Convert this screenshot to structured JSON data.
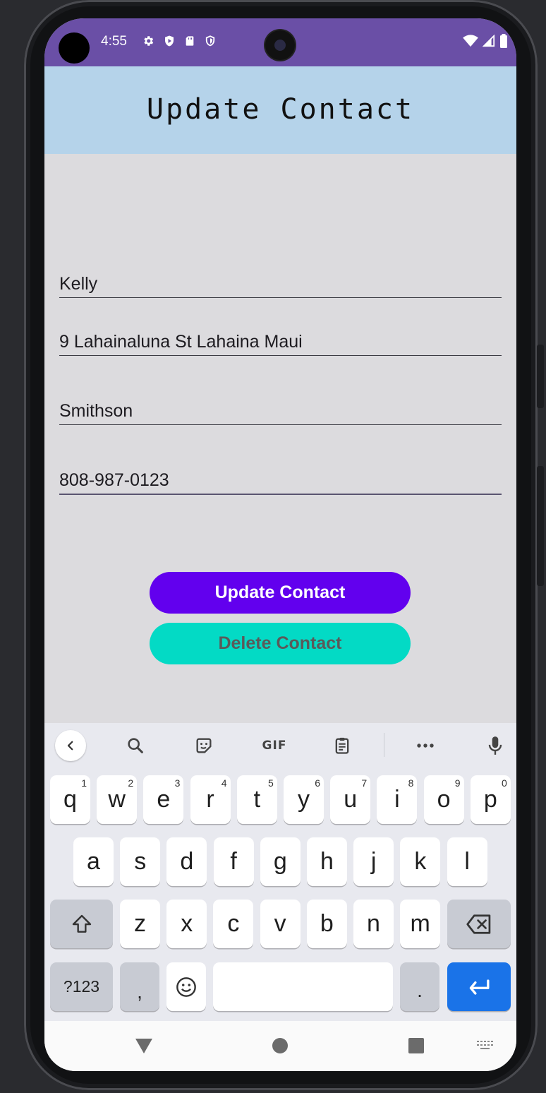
{
  "status_bar": {
    "time": "4:55",
    "left_icons": [
      "gear-icon",
      "play-shield-icon",
      "sd-card-icon",
      "shield-icon"
    ],
    "right_icons": [
      "wifi-icon",
      "signal-icon",
      "battery-icon"
    ]
  },
  "header": {
    "title": "Update Contact"
  },
  "form": {
    "name": "Kelly",
    "address": "9 Lahainaluna St Lahaina Maui",
    "last_name": "Smithson",
    "phone": "808-987-0123"
  },
  "buttons": {
    "update_label": "Update Contact",
    "delete_label": "Delete Contact"
  },
  "colors": {
    "status_bar": "#6a4fa6",
    "header": "#b5d3ea",
    "update_button": "#6200ee",
    "delete_button": "#03dac5",
    "enter_key": "#1a73e8"
  },
  "keyboard": {
    "toolbar": [
      "back-chevron-icon",
      "search-icon",
      "sticker-icon",
      "gif-icon",
      "clipboard-icon",
      "more-icon",
      "mic-icon"
    ],
    "gif_label": "GIF",
    "row1": [
      {
        "k": "q",
        "n": "1"
      },
      {
        "k": "w",
        "n": "2"
      },
      {
        "k": "e",
        "n": "3"
      },
      {
        "k": "r",
        "n": "4"
      },
      {
        "k": "t",
        "n": "5"
      },
      {
        "k": "y",
        "n": "6"
      },
      {
        "k": "u",
        "n": "7"
      },
      {
        "k": "i",
        "n": "8"
      },
      {
        "k": "o",
        "n": "9"
      },
      {
        "k": "p",
        "n": "0"
      }
    ],
    "row2": [
      "a",
      "s",
      "d",
      "f",
      "g",
      "h",
      "j",
      "k",
      "l"
    ],
    "row3": [
      "z",
      "x",
      "c",
      "v",
      "b",
      "n",
      "m"
    ],
    "symbols_label": "?123",
    "comma_label": ",",
    "period_label": "."
  },
  "nav_bar": [
    "back-triangle-icon",
    "home-circle-icon",
    "recents-square-icon",
    "keyboard-switch-icon"
  ]
}
